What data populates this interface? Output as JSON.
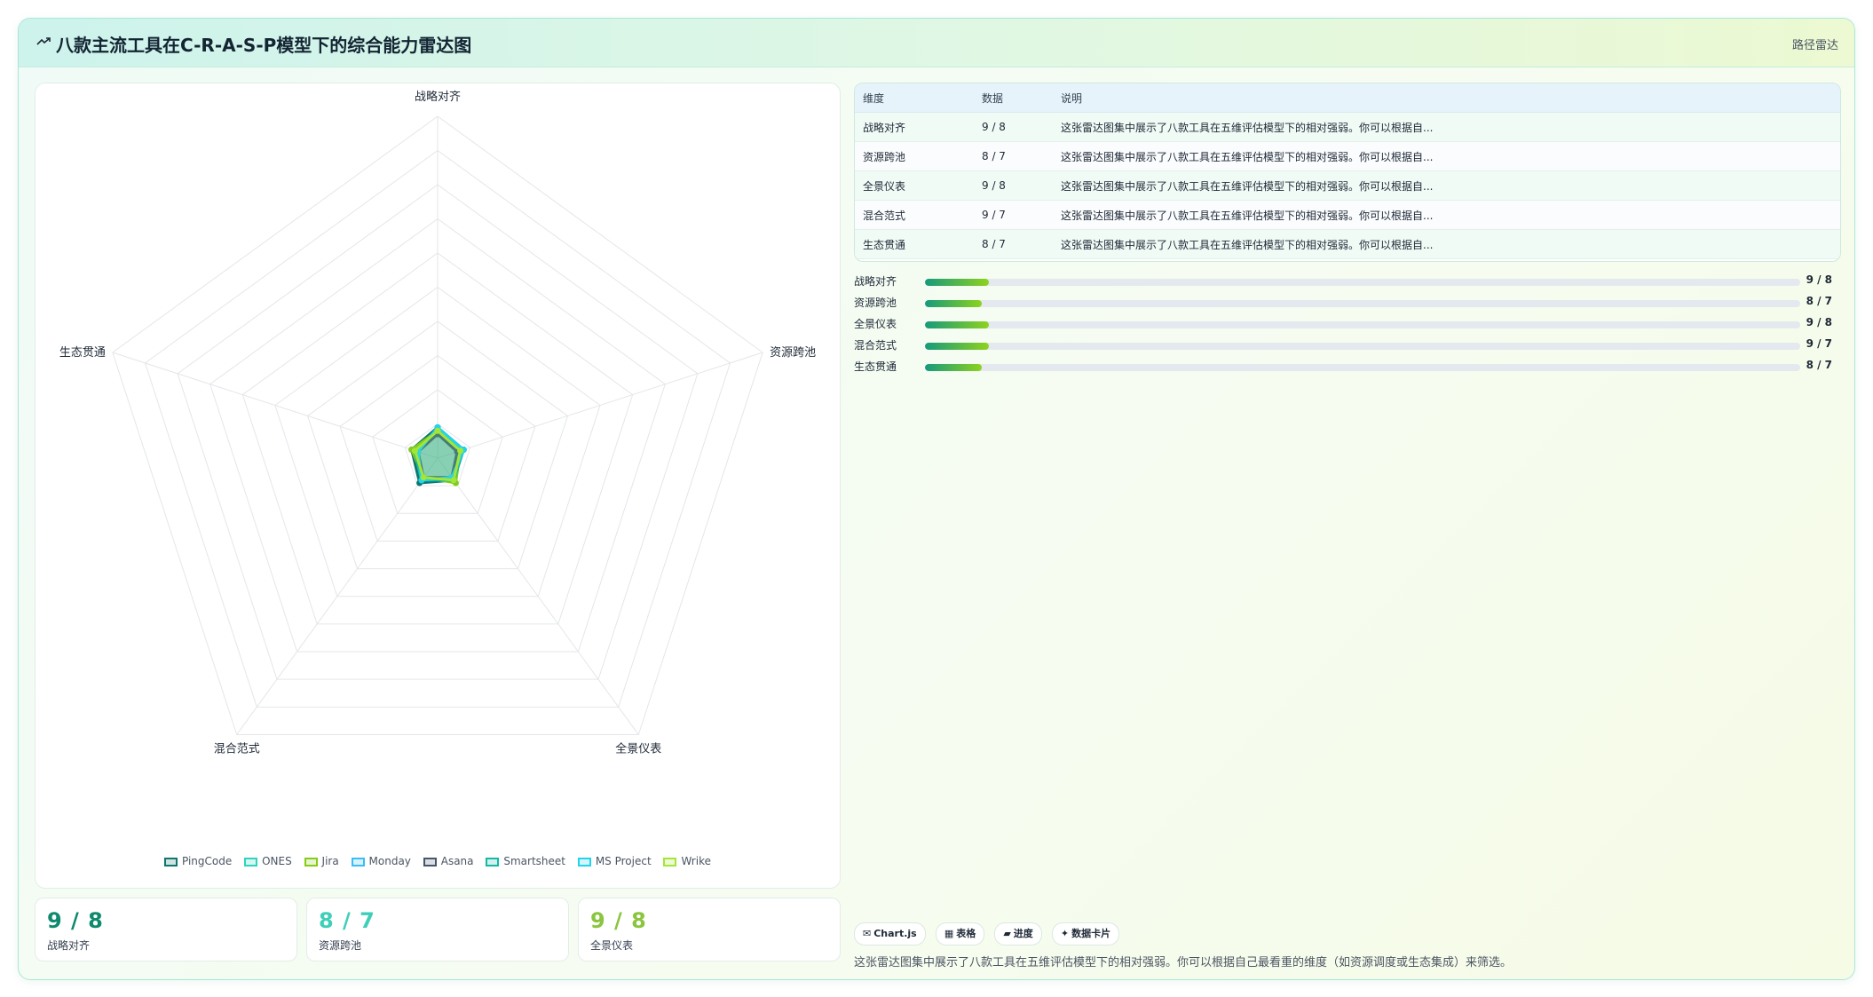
{
  "header": {
    "title": "八款主流工具在C-R-A-S-P模型下的综合能力雷达图",
    "right_label": "路径雷达"
  },
  "chart_data": {
    "type": "radar",
    "axes": [
      "战略对齐",
      "资源跨池",
      "全景仪表",
      "混合范式",
      "生态贯通"
    ],
    "scale_max": 100,
    "rings": 10,
    "grid": true,
    "legend_position": "bottom",
    "series": [
      {
        "name": "PingCode",
        "values": [
          9,
          8,
          8,
          9,
          8
        ],
        "color": "#0f766e"
      },
      {
        "name": "ONES",
        "values": [
          8,
          7,
          7,
          8,
          7
        ],
        "color": "#2dd4bf"
      },
      {
        "name": "Jira",
        "values": [
          8,
          7,
          9,
          7,
          8
        ],
        "color": "#84cc16"
      },
      {
        "name": "Monday",
        "values": [
          7,
          8,
          8,
          7,
          7
        ],
        "color": "#38bdf8"
      },
      {
        "name": "Asana",
        "values": [
          7,
          6,
          7,
          7,
          6
        ],
        "color": "#475569"
      },
      {
        "name": "Smartsheet",
        "values": [
          8,
          8,
          8,
          8,
          7
        ],
        "color": "#14b8a6"
      },
      {
        "name": "MS Project",
        "values": [
          9,
          8,
          7,
          8,
          6
        ],
        "color": "#22d3ee"
      },
      {
        "name": "Wrike",
        "values": [
          8,
          7,
          8,
          7,
          7
        ],
        "color": "#a3e635"
      }
    ]
  },
  "table": {
    "headers": [
      "维度",
      "数据",
      "说明"
    ],
    "rows": [
      {
        "dim": "战略对齐",
        "data": "9 / 8",
        "desc": "这张雷达图集中展示了八款工具在五维评估模型下的相对强弱。你可以根据自..."
      },
      {
        "dim": "资源跨池",
        "data": "8 / 7",
        "desc": "这张雷达图集中展示了八款工具在五维评估模型下的相对强弱。你可以根据自..."
      },
      {
        "dim": "全景仪表",
        "data": "9 / 8",
        "desc": "这张雷达图集中展示了八款工具在五维评估模型下的相对强弱。你可以根据自..."
      },
      {
        "dim": "混合范式",
        "data": "9 / 7",
        "desc": "这张雷达图集中展示了八款工具在五维评估模型下的相对强弱。你可以根据自..."
      },
      {
        "dim": "生态贯通",
        "data": "8 / 7",
        "desc": "这张雷达图集中展示了八款工具在五维评估模型下的相对强弱。你可以根据自..."
      }
    ]
  },
  "progress": [
    {
      "label": "战略对齐",
      "value": "9 / 8",
      "fraction": 0.073
    },
    {
      "label": "资源跨池",
      "value": "8 / 7",
      "fraction": 0.065
    },
    {
      "label": "全景仪表",
      "value": "9 / 8",
      "fraction": 0.073
    },
    {
      "label": "混合范式",
      "value": "9 / 7",
      "fraction": 0.073
    },
    {
      "label": "生态贯通",
      "value": "8 / 7",
      "fraction": 0.065
    }
  ],
  "stats": [
    {
      "value": "9 / 8",
      "label": "战略对齐",
      "color": "#0f8a6f"
    },
    {
      "value": "8 / 7",
      "label": "资源跨池",
      "color": "#3fcfb8"
    },
    {
      "value": "9 / 8",
      "label": "全景仪表",
      "color": "#8bc53f"
    }
  ],
  "chips": [
    {
      "icon": "✉",
      "label": "Chart.js"
    },
    {
      "icon": "▦",
      "label": "表格"
    },
    {
      "icon": "▰",
      "label": "进度"
    },
    {
      "icon": "✦",
      "label": "数据卡片"
    }
  ],
  "footer_note": "这张雷达图集中展示了八款工具在五维评估模型下的相对强弱。你可以根据自己最看重的维度（如资源调度或生态集成）来筛选。"
}
